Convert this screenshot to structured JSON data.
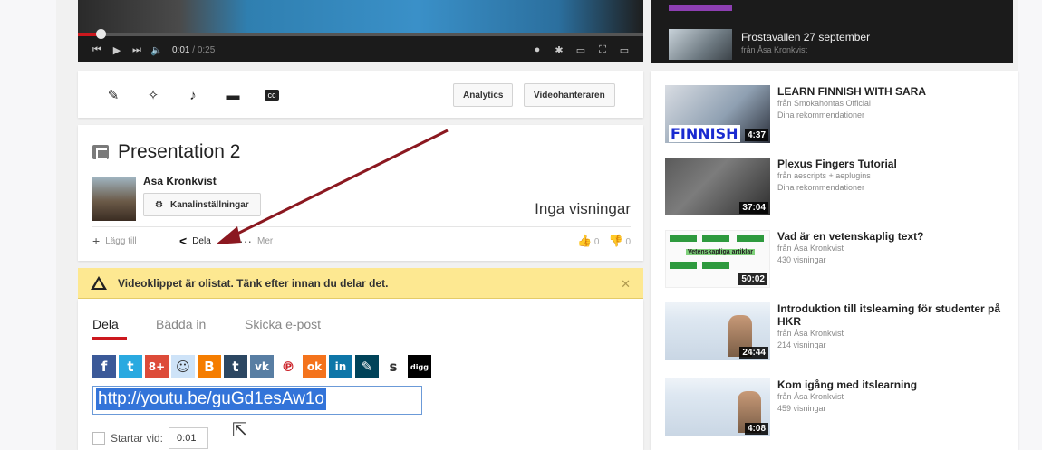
{
  "player": {
    "current_time": "0:01",
    "separator": " / ",
    "duration": "0:25",
    "progress": 0.04
  },
  "upnext": {
    "title": "Frostavallen 27 september",
    "subtitle": "från Åsa Kronkvist"
  },
  "toolbar": {
    "tools": [
      "pencil-icon",
      "magic-wand-icon",
      "music-note-icon",
      "speech-bubble-icon",
      "cc-icon"
    ],
    "cc_text": "cc",
    "analytics_label": "Analytics",
    "video_manager_label": "Videohanteraren"
  },
  "video": {
    "title": "Presentation 2",
    "owner": "Asa Kronkvist",
    "channel_settings_label": "Kanalinställningar",
    "views": "Inga visningar",
    "add_to_label": "Lägg till i",
    "share_label": "Dela",
    "more_label": "Mer",
    "likes": "0",
    "dislikes": "0"
  },
  "warning": {
    "message": "Videoklippet är olistat. Tänk efter innan du delar det."
  },
  "share": {
    "tabs": [
      "Dela",
      "Bädda in",
      "Skicka e-post"
    ],
    "active_tab": "Dela",
    "url": "http://youtu.be/guGd1esAw1o",
    "start_label": "Startar vid:",
    "start_value": "0:01",
    "social": [
      {
        "icon": "facebook-icon",
        "glyph": "f",
        "color": "#3b5998"
      },
      {
        "icon": "twitter-icon",
        "glyph": "t",
        "color": "#2aa9e0"
      },
      {
        "icon": "googleplus-icon",
        "glyph": "8+",
        "color": "#dd4b39"
      },
      {
        "icon": "reddit-icon",
        "glyph": "☺",
        "color": "#cee3f8"
      },
      {
        "icon": "blogger-icon",
        "glyph": "B",
        "color": "#f57d00"
      },
      {
        "icon": "tumblr-icon",
        "glyph": "t",
        "color": "#2c4762"
      },
      {
        "icon": "vk-icon",
        "glyph": "vk",
        "color": "#587ea3"
      },
      {
        "icon": "pinterest-icon",
        "glyph": "℗",
        "color": "#ffffff"
      },
      {
        "icon": "odnoklassniki-icon",
        "glyph": "ok",
        "color": "#f4731c"
      },
      {
        "icon": "linkedin-icon",
        "glyph": "in",
        "color": "#0e76a8"
      },
      {
        "icon": "livejournal-icon",
        "glyph": "✎",
        "color": "#004359"
      },
      {
        "icon": "stumbleupon-icon",
        "glyph": "s",
        "color": "#ffffff"
      },
      {
        "icon": "digg-icon",
        "glyph": "digg",
        "color": "#000000"
      }
    ]
  },
  "sidebar": {
    "videos": [
      {
        "title": "LEARN FINNISH WITH SARA",
        "line1": "från Smokahontas Official",
        "line2": "Dina rekommendationer",
        "duration": "4:37",
        "thumb_text": "FINNISH"
      },
      {
        "title": "Plexus Fingers Tutorial",
        "line1": "från aescripts + aeplugins",
        "line2": "Dina rekommendationer",
        "duration": "37:04"
      },
      {
        "title": "Vad är en vetenskaplig text?",
        "line1": "från Åsa Kronkvist",
        "line2": "430 visningar",
        "duration": "50:02",
        "thumb_text": "Vetenskapliga artiklar"
      },
      {
        "title": "Introduktion till itslearning för studenter på HKR",
        "line1": "från Åsa Kronkvist",
        "line2": "214 visningar",
        "duration": "24:44"
      },
      {
        "title": "Kom igång med itslearning",
        "line1": "från Åsa Kronkvist",
        "line2": "459 visningar",
        "duration": "4:08"
      }
    ]
  }
}
